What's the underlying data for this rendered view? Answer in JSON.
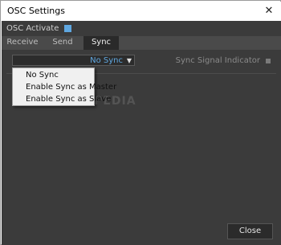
{
  "window": {
    "title": "OSC Settings",
    "close_glyph": "✕"
  },
  "osc": {
    "activate_label": "OSC Activate",
    "activate_checked": true,
    "accent_color": "#5fa7e0"
  },
  "tabs": [
    {
      "label": "Receive"
    },
    {
      "label": "Send"
    },
    {
      "label": "Sync",
      "active": true
    }
  ],
  "sync": {
    "selected": "No Sync",
    "arrow_glyph": "▼",
    "indicator_label": "Sync Signal Indicator",
    "options": [
      "No Sync",
      "Enable Sync as Master",
      "Enable Sync as Slave"
    ]
  },
  "watermark": "SOFTPEDIA",
  "footer": {
    "close_label": "Close"
  }
}
